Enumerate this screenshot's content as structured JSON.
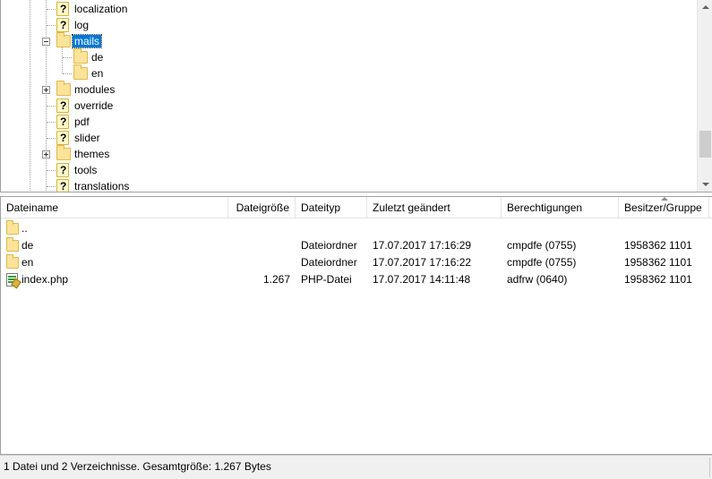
{
  "tree": {
    "items": [
      {
        "label": "localization",
        "icon": "question-icon"
      },
      {
        "label": "log",
        "icon": "question-icon"
      },
      {
        "label": "mails",
        "icon": "folder-icon",
        "expanded": true,
        "selected": true
      },
      {
        "label": "de",
        "icon": "folder-icon"
      },
      {
        "label": "en",
        "icon": "folder-icon"
      },
      {
        "label": "modules",
        "icon": "folder-icon",
        "collapsed": true
      },
      {
        "label": "override",
        "icon": "question-icon"
      },
      {
        "label": "pdf",
        "icon": "question-icon"
      },
      {
        "label": "slider",
        "icon": "question-icon"
      },
      {
        "label": "themes",
        "icon": "folder-icon",
        "collapsed": true
      },
      {
        "label": "tools",
        "icon": "question-icon"
      },
      {
        "label": "translations",
        "icon": "question-icon"
      }
    ]
  },
  "list": {
    "columns": {
      "name": "Dateiname",
      "size": "Dateigröße",
      "type": "Dateityp",
      "modified": "Zuletzt geändert",
      "permissions": "Berechtigungen",
      "owner": "Besitzer/Gruppe"
    },
    "rows": [
      {
        "name": "..",
        "size": "",
        "type": "",
        "modified": "",
        "permissions": "",
        "owner": "",
        "icon": "folder-icon"
      },
      {
        "name": "de",
        "size": "",
        "type": "Dateiordner",
        "modified": "17.07.2017 17:16:29",
        "permissions": "cmpdfe (0755)",
        "owner": "1958362 1101",
        "icon": "folder-icon"
      },
      {
        "name": "en",
        "size": "",
        "type": "Dateiordner",
        "modified": "17.07.2017 17:16:22",
        "permissions": "cmpdfe (0755)",
        "owner": "1958362 1101",
        "icon": "folder-icon"
      },
      {
        "name": "index.php",
        "size": "1.267",
        "type": "PHP-Datei",
        "modified": "17.07.2017 14:11:48",
        "permissions": "adfrw (0640)",
        "owner": "1958362 1101",
        "icon": "php-file-icon"
      }
    ]
  },
  "status": {
    "text": "1 Datei und 2 Verzeichnisse. Gesamtgröße: 1.267 Bytes"
  },
  "colors": {
    "selection": "#0078d7",
    "folder": "#fbe39a",
    "statusbar": "#f0f0f0"
  }
}
